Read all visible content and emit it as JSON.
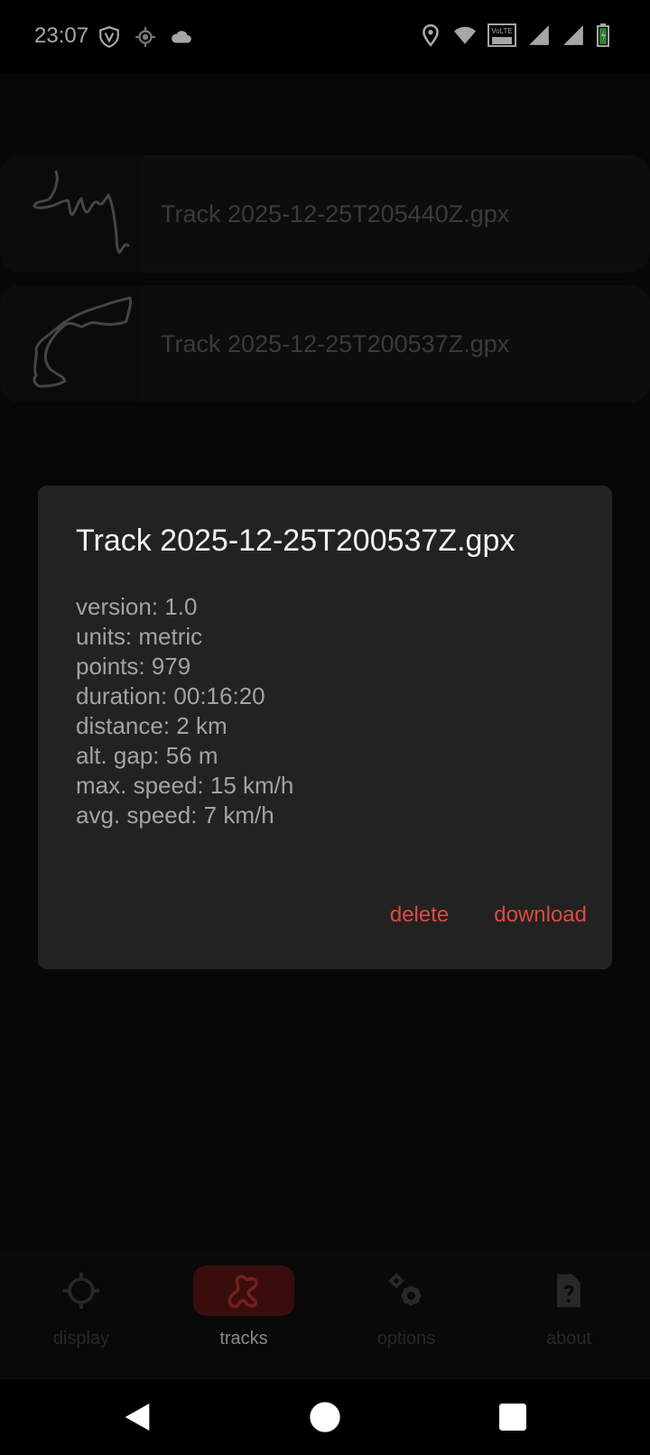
{
  "status_bar": {
    "time": "23:07",
    "left_icons": [
      "vpn-shield-icon",
      "location-target-icon",
      "cloud-icon"
    ],
    "right_icons": [
      "location-pin-icon",
      "wifi-icon",
      "volte-icon",
      "signal-icon",
      "signal-icon",
      "battery-charging-icon"
    ],
    "volte_label": "VoLTE"
  },
  "tracks": [
    {
      "name": "Track 2025-12-25T205440Z.gpx",
      "thumbnail_icon": "track-thumbnail-icon"
    },
    {
      "name": "Track 2025-12-25T200537Z.gpx",
      "thumbnail_icon": "track-thumbnail-icon"
    }
  ],
  "dialog": {
    "title": "Track 2025-12-25T200537Z.gpx",
    "info": [
      "version: 1.0",
      "units: metric",
      "points: 979",
      "duration: 00:16:20",
      "distance: 2 km",
      "alt. gap: 56 m",
      "max. speed: 15 km/h",
      "avg. speed: 7 km/h"
    ],
    "delete_label": "delete",
    "download_label": "download"
  },
  "bottom_nav": [
    {
      "label": "display",
      "icon": "crosshair-icon",
      "active": false
    },
    {
      "label": "tracks",
      "icon": "track-route-icon",
      "active": true
    },
    {
      "label": "options",
      "icon": "gears-icon",
      "active": false
    },
    {
      "label": "about",
      "icon": "help-document-icon",
      "active": false
    }
  ],
  "colors": {
    "accent": "#e0483e",
    "active_pill": "#5a1515",
    "dialog_bg": "#222222",
    "background": "#0a0a0a"
  },
  "system_nav": [
    "back-icon",
    "home-icon",
    "recents-icon"
  ]
}
